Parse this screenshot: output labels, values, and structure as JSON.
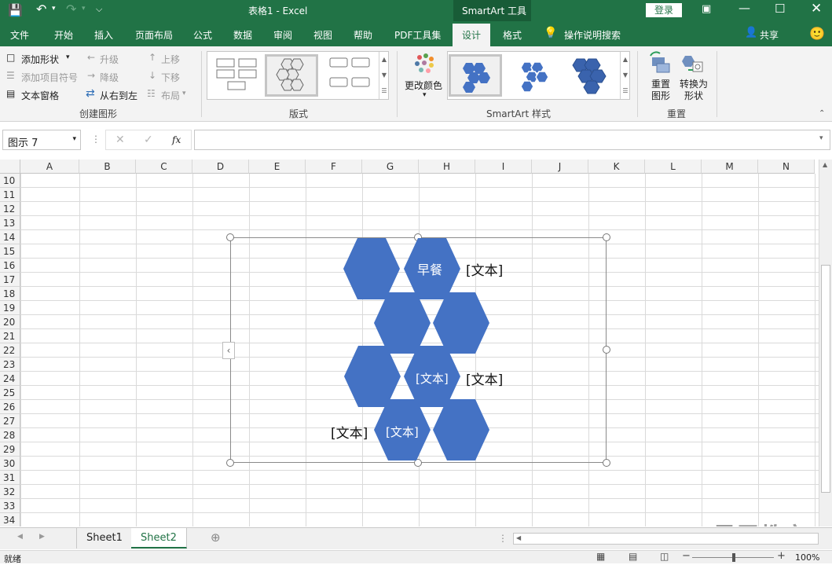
{
  "titlebar": {
    "title": "表格1  -  Excel",
    "context_tab": "SmartArt 工具",
    "login": "登录"
  },
  "tabs": [
    {
      "label": "文件"
    },
    {
      "label": "开始"
    },
    {
      "label": "插入"
    },
    {
      "label": "页面布局"
    },
    {
      "label": "公式"
    },
    {
      "label": "数据"
    },
    {
      "label": "审阅"
    },
    {
      "label": "视图"
    },
    {
      "label": "帮助"
    },
    {
      "label": "PDF工具集"
    },
    {
      "label": "设计"
    },
    {
      "label": "格式"
    }
  ],
  "tell_me": "操作说明搜索",
  "share": "共享",
  "ribbon": {
    "create": {
      "add_shape": "添加形状",
      "add_bullet": "添加项目符号",
      "text_pane": "文本窗格",
      "promote": "升级",
      "demote": "降级",
      "rtl": "从右到左",
      "move_up": "上移",
      "move_down": "下移",
      "layout": "布局",
      "label": "创建图形"
    },
    "layouts_label": "版式",
    "change_colors": "更改颜色",
    "styles_label": "SmartArt 样式",
    "reset": {
      "reset_graphic": "重置\n图形",
      "convert": "转换为\n形状",
      "label": "重置"
    }
  },
  "formula": {
    "name_box": "图示 7",
    "fx": "fx",
    "value": ""
  },
  "columns": [
    "A",
    "B",
    "C",
    "D",
    "E",
    "F",
    "G",
    "H",
    "I",
    "J",
    "K",
    "L",
    "M",
    "N"
  ],
  "rows": [
    "10",
    "11",
    "12",
    "13",
    "14",
    "15",
    "16",
    "17",
    "18",
    "19",
    "20",
    "21",
    "22",
    "23",
    "24",
    "25",
    "26",
    "27",
    "28",
    "29",
    "30",
    "31",
    "32",
    "33",
    "34"
  ],
  "smartart": {
    "hex_texts": [
      "早餐",
      "[文本]",
      "[文本]"
    ],
    "side_texts": [
      "[文本]",
      "[文本]",
      "[文本]"
    ],
    "fill": "#4472c4"
  },
  "sheets": [
    {
      "label": "Sheet1"
    },
    {
      "label": "Sheet2"
    }
  ],
  "status": {
    "ready": "就绪",
    "zoom": "100%"
  },
  "watermark": "最需教育"
}
